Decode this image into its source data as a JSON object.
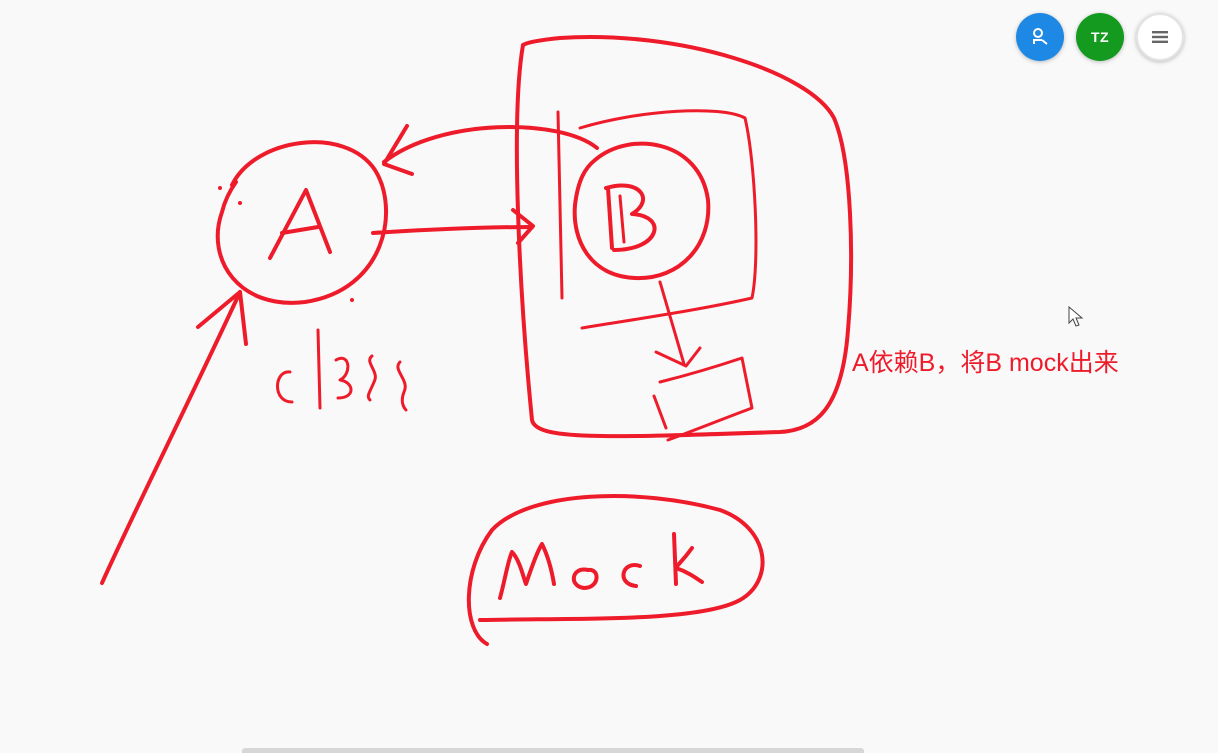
{
  "toolbar": {
    "user_icon": "person-icon",
    "user_button_color": "#1e88e5",
    "avatar_initials": "TZ",
    "avatar_color": "#139a1f",
    "menu_icon": "hamburger-menu-icon"
  },
  "whiteboard": {
    "ink_color": "#ee1c2b",
    "handwriting": [
      "A",
      "B",
      "class",
      "Mock"
    ],
    "annotation": "A依赖B，将B mock出来"
  }
}
